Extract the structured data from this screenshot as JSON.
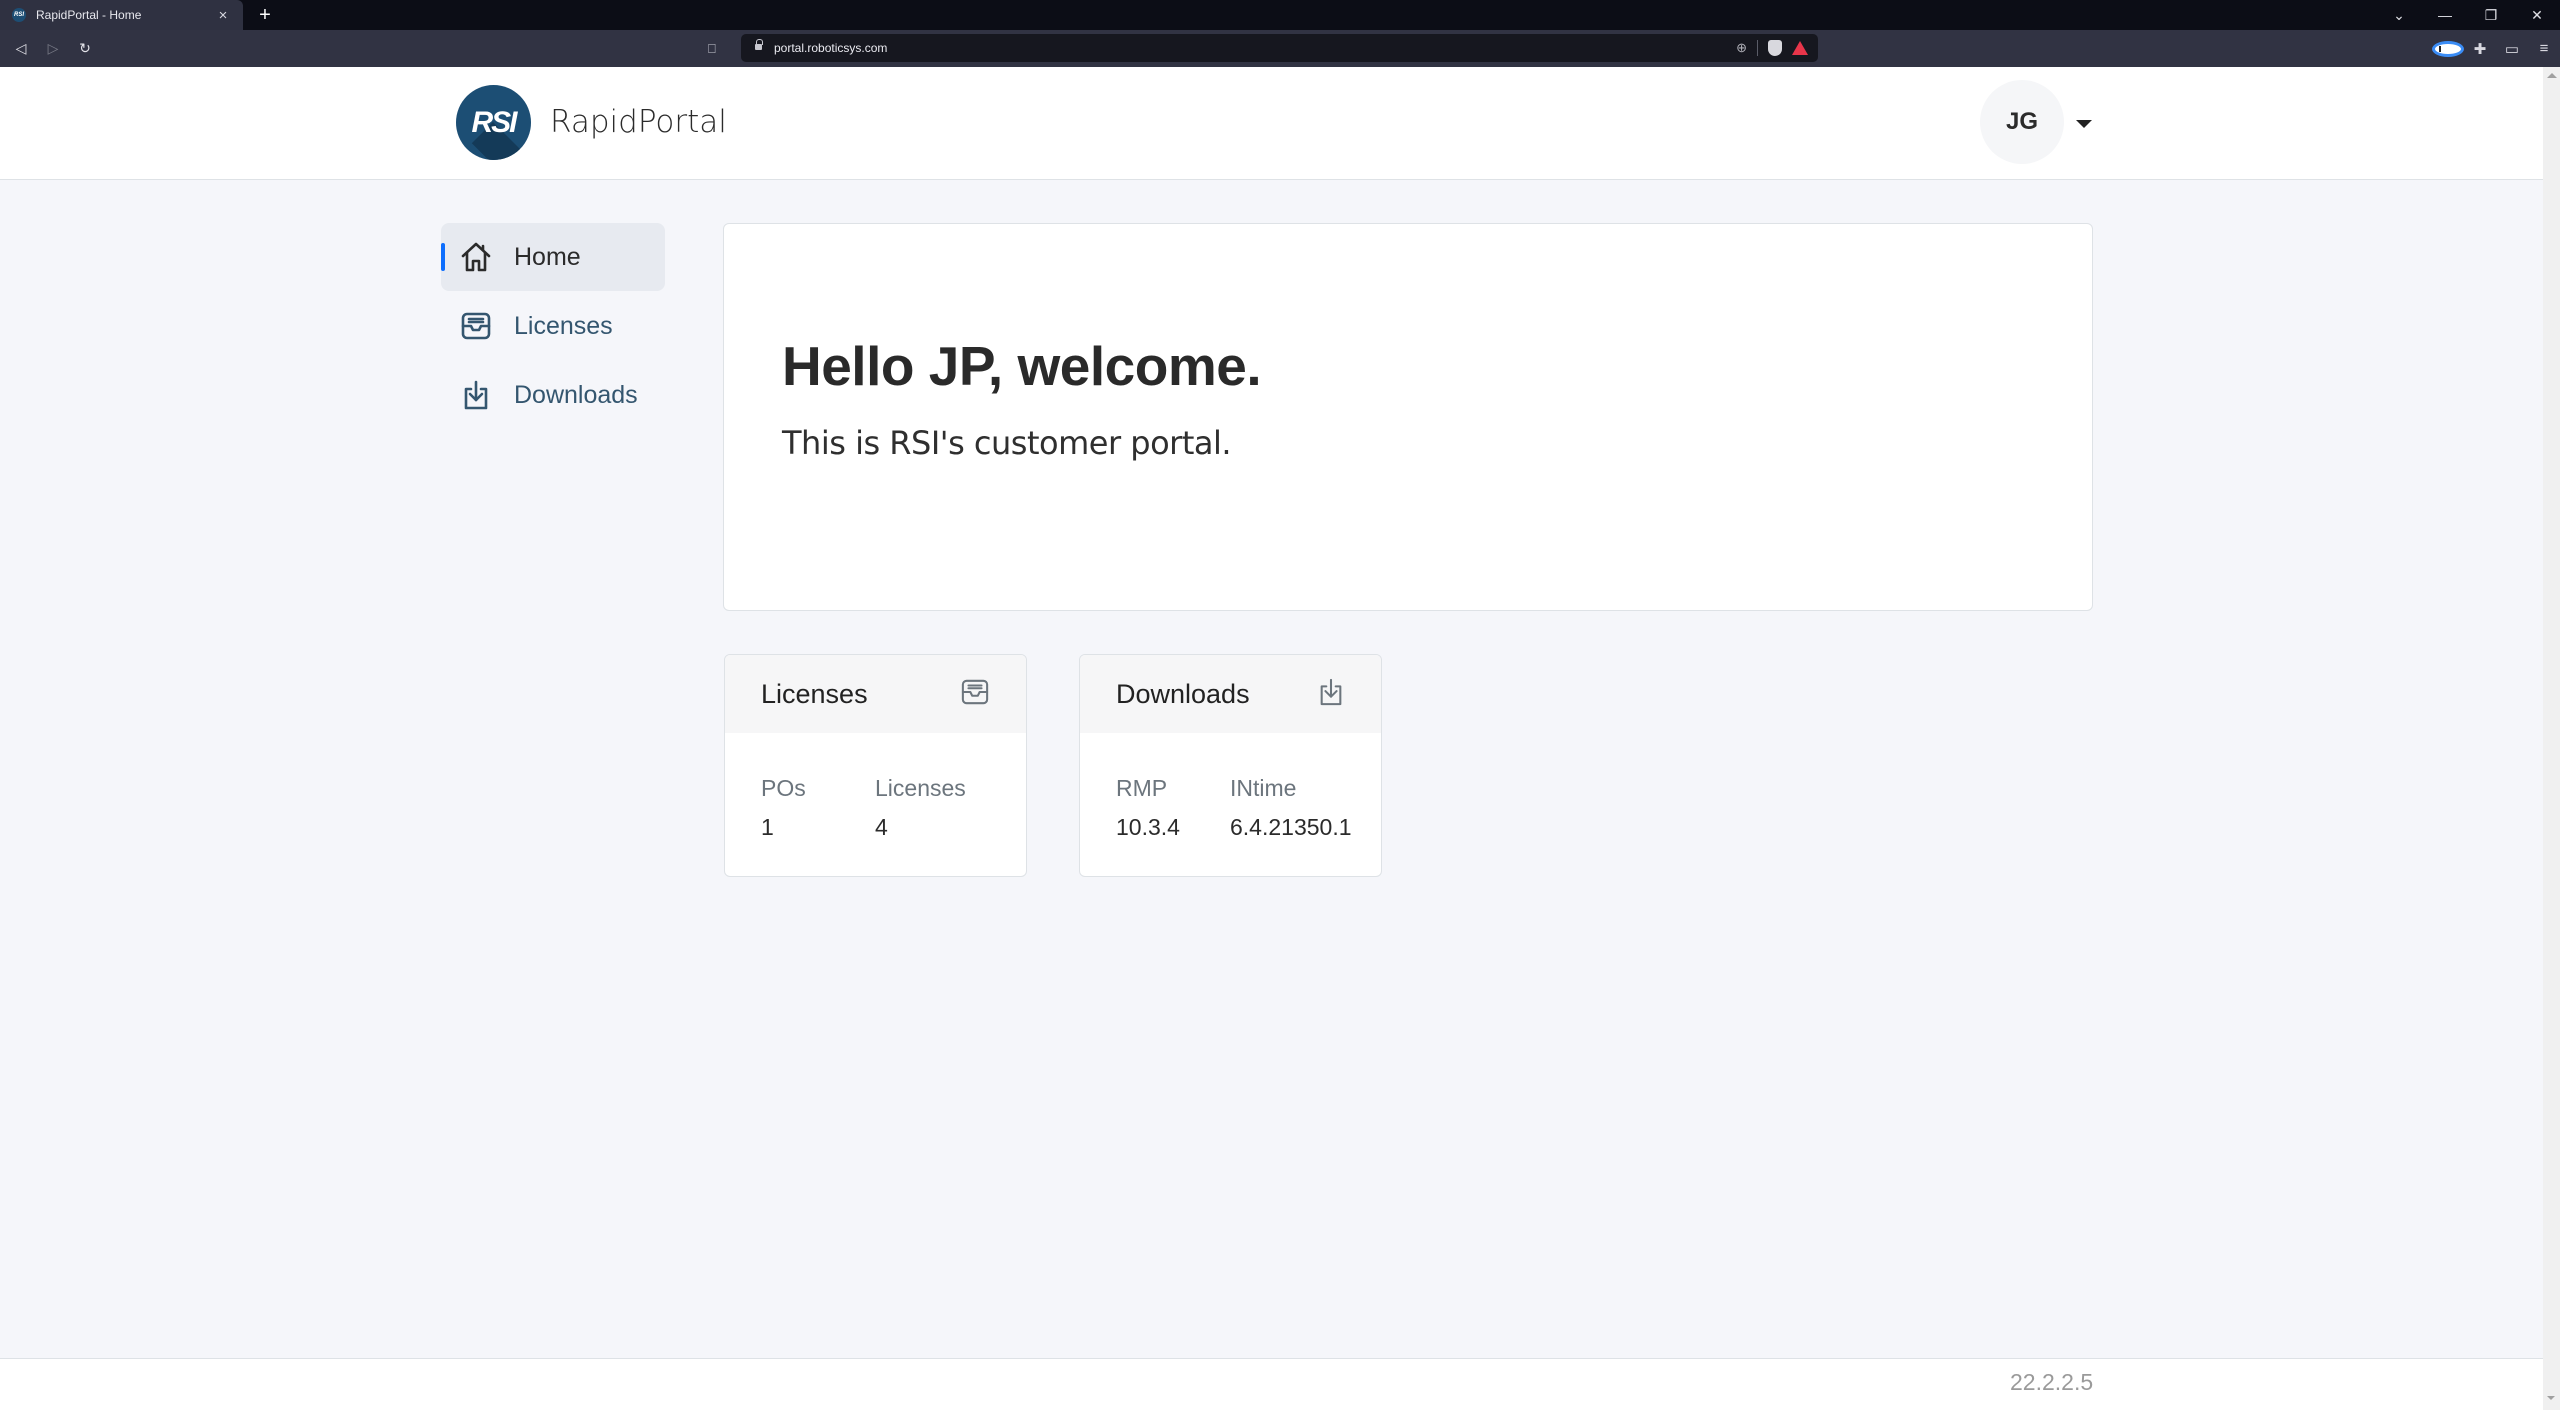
{
  "browser": {
    "tab_title": "RapidPortal - Home",
    "tab_favicon": "RSI",
    "tab_close": "×",
    "new_tab": "+",
    "url": "portal.roboticsys.com",
    "window_controls": {
      "tab_search": "⌄",
      "minimize": "—",
      "restore": "❐",
      "close": "✕"
    },
    "nav": {
      "back": "◁",
      "forward": "▷",
      "reload": "↻"
    },
    "bookmark": "⎕",
    "zoom_icon": "⊕",
    "extensions": {
      "puzzle": "✚",
      "wallet": "▭",
      "menu": "≡"
    }
  },
  "header": {
    "logo_text": "RSI",
    "brand": "RapidPortal",
    "user_initials": "JG"
  },
  "sidebar": {
    "items": [
      {
        "label": "Home",
        "icon": "home-icon",
        "active": true
      },
      {
        "label": "Licenses",
        "icon": "inbox-icon",
        "active": false
      },
      {
        "label": "Downloads",
        "icon": "download-icon",
        "active": false
      }
    ]
  },
  "welcome": {
    "title": "Hello JP, welcome.",
    "subtitle": "This is RSI's customer portal."
  },
  "cards": {
    "licenses": {
      "title": "Licenses",
      "icon": "inbox-icon",
      "stats": [
        {
          "label": "POs",
          "value": "1"
        },
        {
          "label": "Licenses",
          "value": "4"
        }
      ]
    },
    "downloads": {
      "title": "Downloads",
      "icon": "download-icon",
      "stats": [
        {
          "label": "RMP",
          "value": "10.3.4"
        },
        {
          "label": "INtime",
          "value": "6.4.21350.1"
        }
      ]
    }
  },
  "footer": {
    "version": "22.2.2.5"
  },
  "colors": {
    "accent": "#0d6efd",
    "brand_blue": "#1c4e74",
    "sidebar_link": "#34566f",
    "page_bg": "#f5f6fa"
  }
}
